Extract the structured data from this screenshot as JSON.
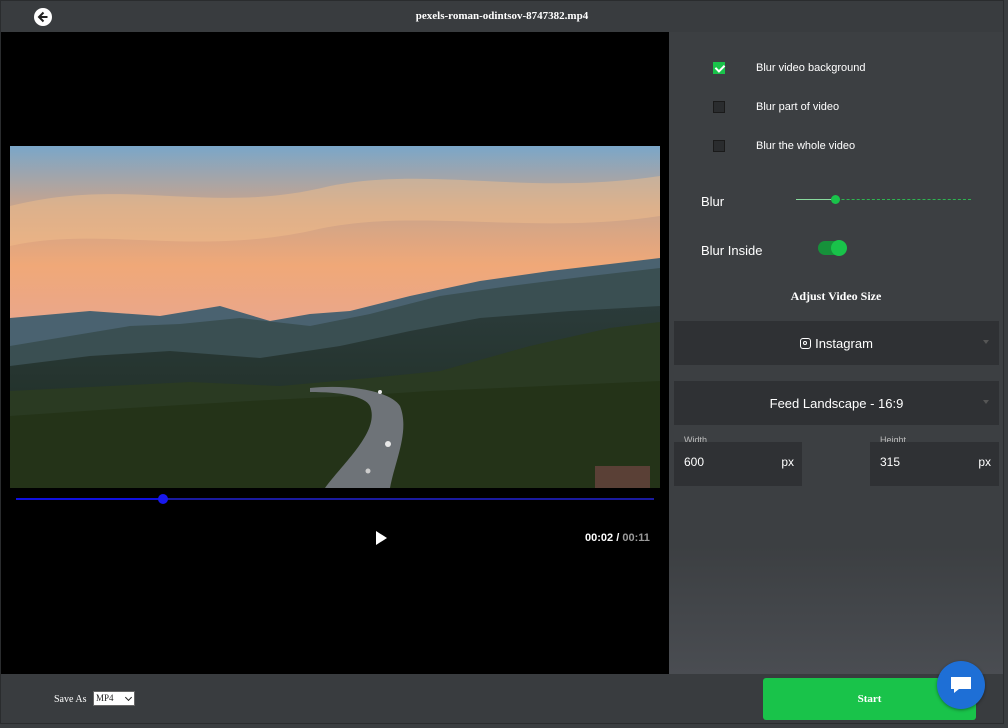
{
  "header": {
    "title": "pexels-roman-odintsov-8747382.mp4",
    "back_icon": "back-arrow-icon"
  },
  "player": {
    "current_time": "00:02",
    "separator": "/",
    "duration": "00:11",
    "progress_fraction": 0.23,
    "play_icon": "play-icon"
  },
  "options": {
    "items": [
      {
        "label": "Blur video background",
        "checked": true
      },
      {
        "label": "Blur part of video",
        "checked": false
      },
      {
        "label": "Blur the whole video",
        "checked": false
      }
    ]
  },
  "blur": {
    "label": "Blur",
    "level_fraction": 0.22
  },
  "blur_inside": {
    "label": "Blur Inside",
    "on": true
  },
  "adjust": {
    "title": "Adjust Video Size",
    "platform": "Instagram",
    "preset": "Feed Landscape - 16:9",
    "width_label": "Width",
    "width_value": "600",
    "height_label": "Height",
    "height_value": "315",
    "unit": "px"
  },
  "footer": {
    "save_as_label": "Save As",
    "format": "MP4",
    "start_label": "Start"
  },
  "colors": {
    "accent": "#19c34a",
    "chat": "#1e6fd6",
    "progress": "#1010e0"
  }
}
